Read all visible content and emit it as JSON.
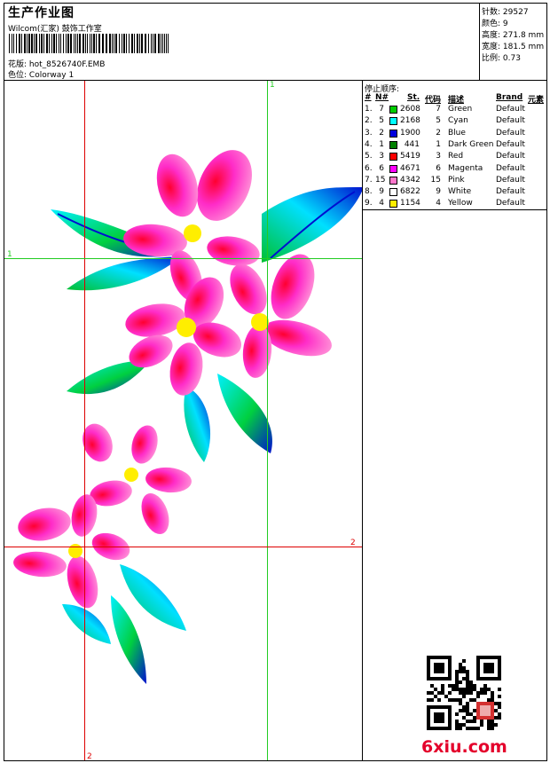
{
  "header": {
    "title": "生产作业图",
    "company": "Wilcom(汇家) 鼓饰工作室",
    "design_label": "花版:",
    "design_file": "hot_8526740F.EMB",
    "color_label": "色位:",
    "colorway": "Colorway 1"
  },
  "stats": [
    {
      "label": "针数:",
      "value": "29527"
    },
    {
      "label": "颜色:",
      "value": "9"
    },
    {
      "label": "高度:",
      "value": "271.8 mm"
    },
    {
      "label": "宽度:",
      "value": "181.5 mm"
    },
    {
      "label": "比例:",
      "value": "0.73"
    }
  ],
  "guides": {
    "top_label": "1",
    "left_label": "1",
    "right_label": "2",
    "bottom_label": "2",
    "color_green": "#22cc22",
    "color_red": "#dd0000"
  },
  "stops": {
    "title": "停止顺序:",
    "headers": [
      "#",
      "N#",
      "St.",
      "代码",
      "描述",
      "Brand",
      "元素"
    ],
    "rows": [
      {
        "idx": "1.",
        "n": "7",
        "st": "2608",
        "code": "7",
        "desc": "Green",
        "brand": "Default",
        "color": "#00cc00"
      },
      {
        "idx": "2.",
        "n": "5",
        "st": "2168",
        "code": "5",
        "desc": "Cyan",
        "brand": "Default",
        "color": "#00ffff"
      },
      {
        "idx": "3.",
        "n": "2",
        "st": "1900",
        "code": "2",
        "desc": "Blue",
        "brand": "Default",
        "color": "#0000dd"
      },
      {
        "idx": "4.",
        "n": "1",
        "st": "441",
        "code": "1",
        "desc": "Dark Green",
        "brand": "Default",
        "color": "#008000"
      },
      {
        "idx": "5.",
        "n": "3",
        "st": "5419",
        "code": "3",
        "desc": "Red",
        "brand": "Default",
        "color": "#ff0000"
      },
      {
        "idx": "6.",
        "n": "6",
        "st": "4671",
        "code": "6",
        "desc": "Magenta",
        "brand": "Default",
        "color": "#ff00ff"
      },
      {
        "idx": "7.",
        "n": "15",
        "st": "4342",
        "code": "15",
        "desc": "Pink",
        "brand": "Default",
        "color": "#ff77cc"
      },
      {
        "idx": "8.",
        "n": "9",
        "st": "6822",
        "code": "9",
        "desc": "White",
        "brand": "Default",
        "color": "#ffffff"
      },
      {
        "idx": "9.",
        "n": "4",
        "st": "1154",
        "code": "4",
        "desc": "Yellow",
        "brand": "Default",
        "color": "#ffee00"
      }
    ]
  },
  "brand": {
    "text": "6xiu.com",
    "color": "#e4002b"
  }
}
